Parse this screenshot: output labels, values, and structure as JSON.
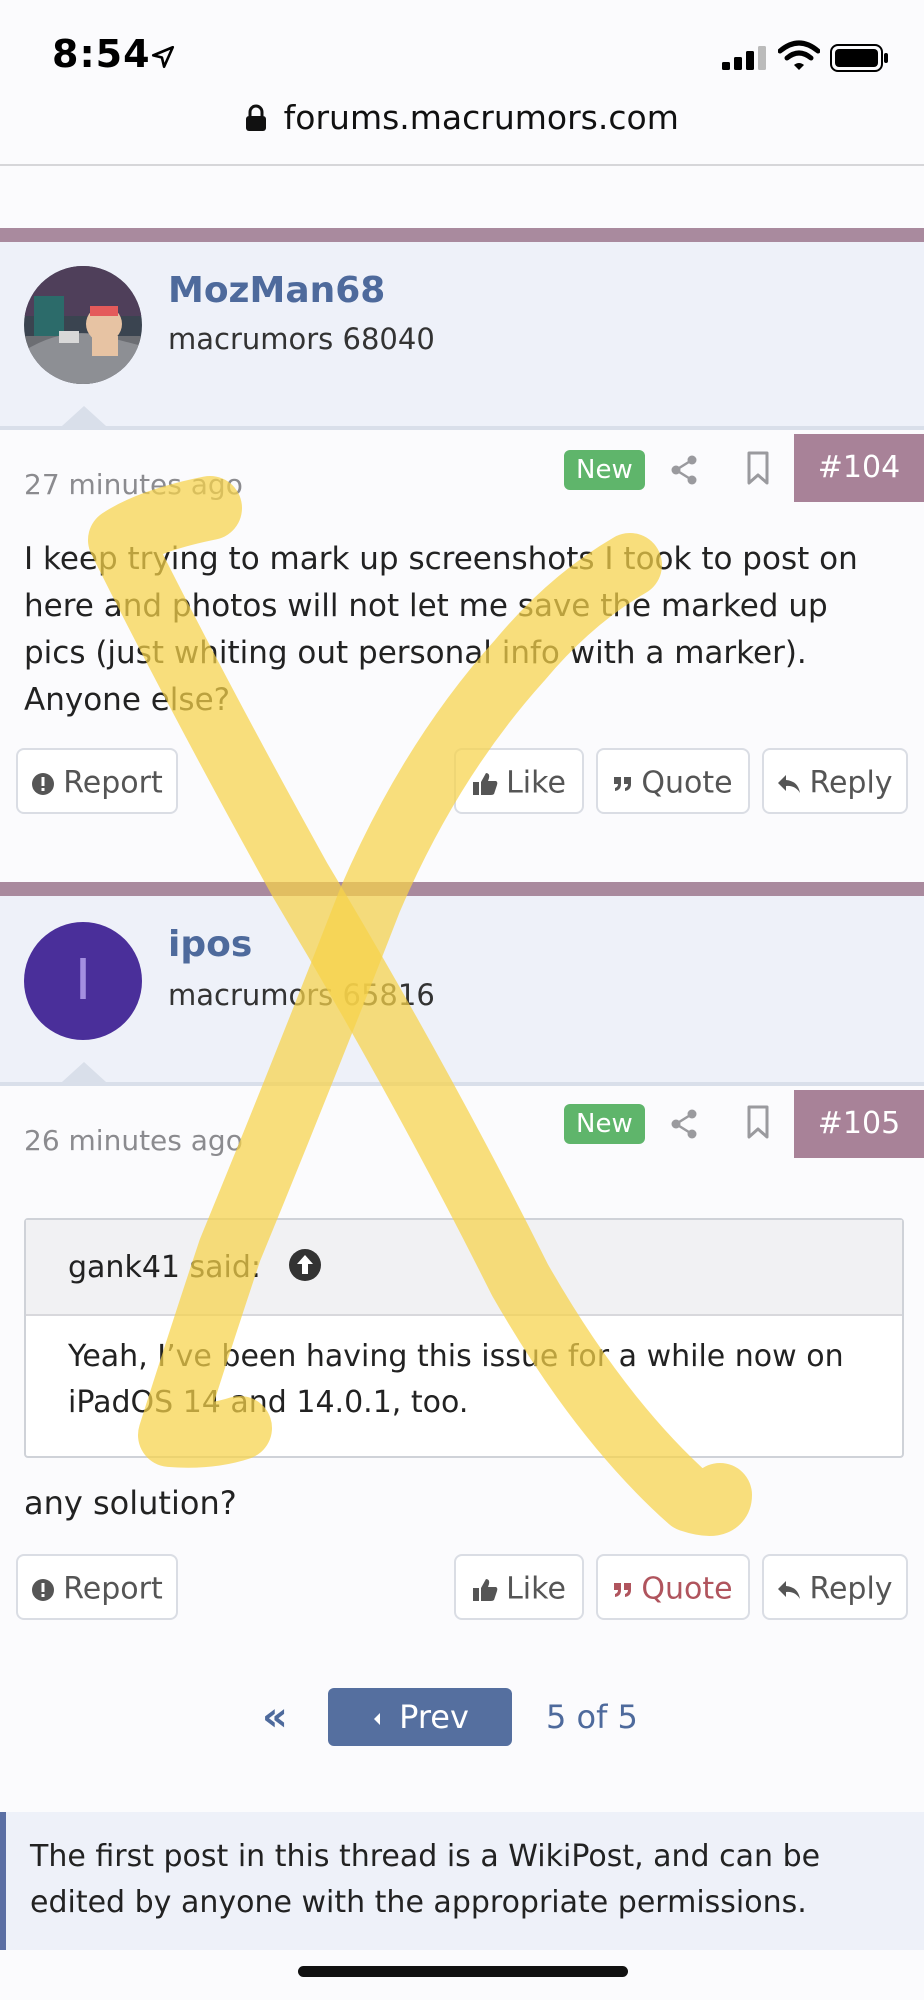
{
  "status_bar": {
    "time": "8:54"
  },
  "browser": {
    "url": "forums.macrumors.com"
  },
  "posts": [
    {
      "username": "MozMan68",
      "user_title": "macrumors 68040",
      "time_ago": "27 minutes ago",
      "badge": "New",
      "number": "#104",
      "body": "I keep trying to mark up screenshots I took to post on here and photos will not let me save the marked up pics (just whiting out personal info with a marker). Anyone else?",
      "actions": {
        "report": "Report",
        "like": "Like",
        "quote": "Quote",
        "reply": "Reply"
      }
    },
    {
      "username": "ipos",
      "avatar_letter": "I",
      "avatar_color": "#4a2f9a",
      "user_title": "macrumors 65816",
      "time_ago": "26 minutes ago",
      "badge": "New",
      "number": "#105",
      "quote": {
        "author_label": "gank41 said:",
        "text": "Yeah, I’ve been having this issue for a while now on iPadOS 14 and 14.0.1, too."
      },
      "body": "any solution?",
      "actions": {
        "report": "Report",
        "like": "Like",
        "quote": "Quote",
        "reply": "Reply"
      }
    }
  ],
  "pagination": {
    "first": "«",
    "prev": "Prev",
    "status": "5 of 5"
  },
  "notice": "The first post in this thread is a WikiPost, and can be edited by anyone with the appropriate permissions.",
  "colors": {
    "accent": "#4e6a9c",
    "post_bar": "#a98a9e",
    "badge_new": "#5fb56b",
    "markup": "#f7d24a"
  },
  "icons": [
    "location-arrow-icon",
    "signal-icon",
    "wifi-icon",
    "battery-icon",
    "lock-icon",
    "share-icon",
    "bookmark-icon",
    "report-icon",
    "like-icon",
    "quote-icon",
    "reply-icon",
    "quote-arrow-icon",
    "chevron-left-icon"
  ]
}
